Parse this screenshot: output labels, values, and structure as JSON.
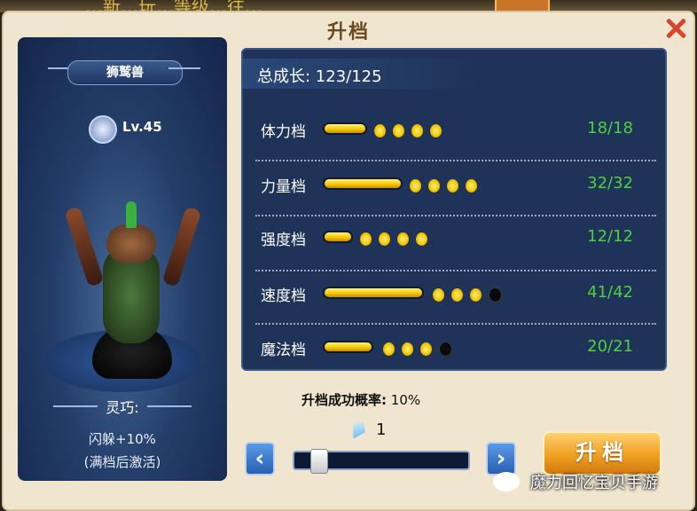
{
  "top_ticker": "…新…玩…等级…往…",
  "window": {
    "title": "升档"
  },
  "pet": {
    "name": "狮鹫兽",
    "level": "Lv.45",
    "stat_name": "灵巧:",
    "bonus": "闪躲+10%",
    "activate_note": "(满档后激活)"
  },
  "growth": {
    "total": "总成长: 123/125",
    "rows": [
      {
        "label": "体力档",
        "value": "18/18",
        "fill": 1.0,
        "dots_on": 4,
        "dots_off": 0
      },
      {
        "label": "力量档",
        "value": "32/32",
        "fill": 1.0,
        "dots_on": 4,
        "dots_off": 0
      },
      {
        "label": "强度档",
        "value": "12/12",
        "fill": 1.0,
        "dots_on": 4,
        "dots_off": 0
      },
      {
        "label": "速度档",
        "value": "41/42",
        "fill": 0.98,
        "dots_on": 3,
        "dots_off": 1
      },
      {
        "label": "魔法档",
        "value": "20/21",
        "fill": 0.95,
        "dots_on": 3,
        "dots_off": 1
      }
    ]
  },
  "upgrade": {
    "rate_label": "升档成功概率:",
    "rate_value": "10%",
    "crystal_count": "1",
    "slider_value": 0.1,
    "button_label": "升档",
    "prev_arrow": "‹",
    "next_arrow": "›"
  },
  "watermark": "魔力回忆宝贝手游",
  "colors": {
    "accent_gold": "#f2c200",
    "value_green": "#4cd040",
    "panel_blue": "#1f3358"
  }
}
